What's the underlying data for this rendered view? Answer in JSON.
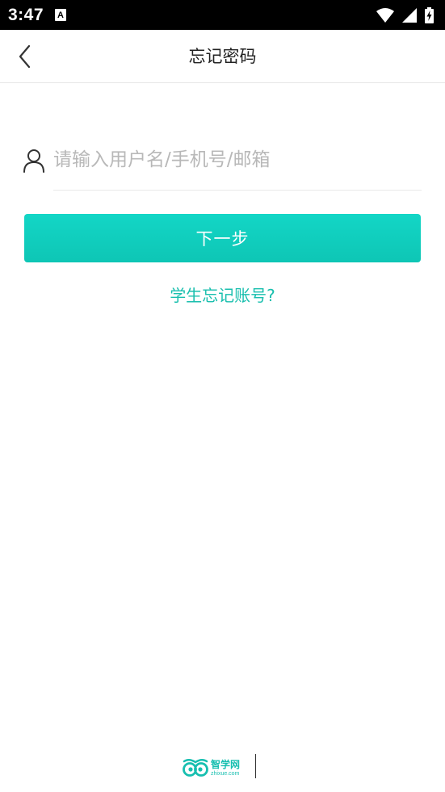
{
  "status_bar": {
    "time": "3:47",
    "notification_icon": "a-icon",
    "icons": [
      "wifi-icon",
      "signal-icon",
      "battery-charging-icon"
    ]
  },
  "app_bar": {
    "back_icon": "chevron-left-icon",
    "title": "忘记密码"
  },
  "form": {
    "account_icon": "user-icon",
    "account_value": "",
    "account_placeholder": "请输入用户名/手机号/邮箱",
    "next_label": "下一步",
    "student_link": "学生忘记账号?"
  },
  "footer": {
    "logo_icon": "owl-logo-icon",
    "logo_name": "智学网",
    "logo_domain": "zhixue.com"
  },
  "colors": {
    "accent": "#13d6c6",
    "link": "#19bfae",
    "placeholder": "#b8b8b8",
    "status_bar": "#000000"
  }
}
